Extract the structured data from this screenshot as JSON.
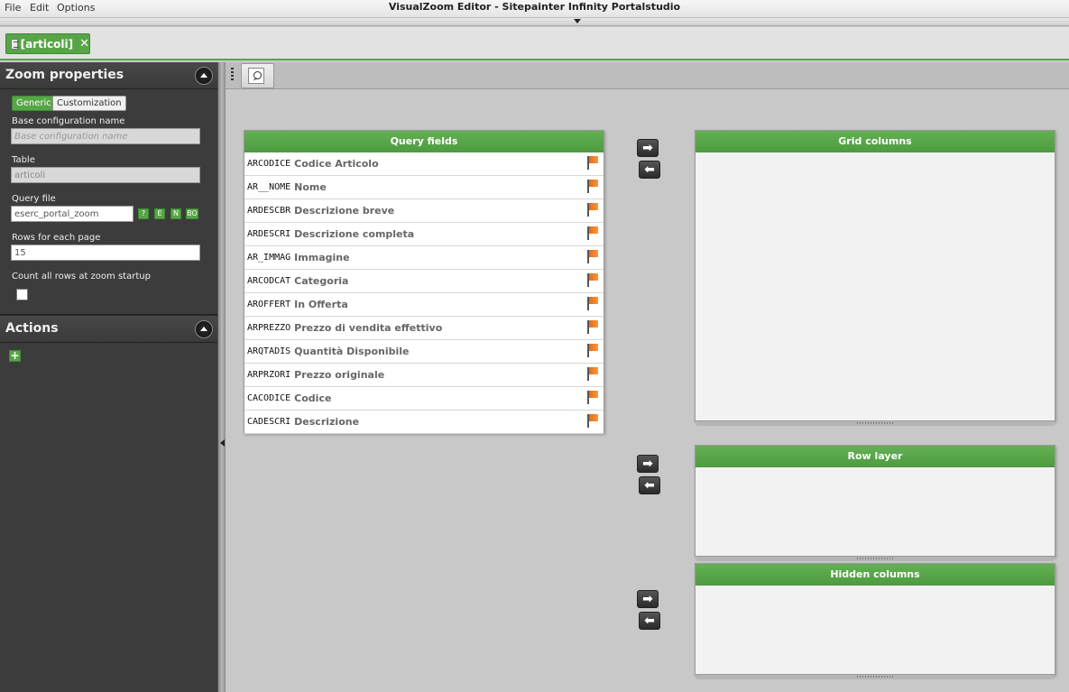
{
  "menu": {
    "file": "File",
    "edit": "Edit",
    "options": "Options"
  },
  "app_title": "VisualZoom Editor - Sitepainter Infinity Portalstudio",
  "doc_tab": {
    "label": "[articoli]",
    "close": "✕"
  },
  "zoom_properties": {
    "title": "Zoom properties",
    "tabs": [
      "Generic",
      "Customization"
    ],
    "base_config_label": "Base configuration name",
    "base_config_placeholder": "Base configuration name",
    "table_label": "Table",
    "table_value": "articoli",
    "query_file_label": "Query file",
    "query_file_value": "eserc_portal_zoom",
    "query_buttons": [
      "?",
      "E",
      "N",
      "BO"
    ],
    "rows_label": "Rows for each page",
    "rows_value": "15",
    "count_rows_label": "Count all rows at zoom startup",
    "count_rows_checked": false
  },
  "actions": {
    "title": "Actions",
    "add": "+"
  },
  "query_fields": {
    "title": "Query fields",
    "rows": [
      {
        "name": "ARCODICE",
        "desc": "Codice Articolo"
      },
      {
        "name": "AR__NOME",
        "desc": "Nome"
      },
      {
        "name": "ARDESCBR",
        "desc": "Descrizione breve"
      },
      {
        "name": "ARDESCRI",
        "desc": "Descrizione completa"
      },
      {
        "name": "AR_IMMAG",
        "desc": "Immagine"
      },
      {
        "name": "ARCODCAT",
        "desc": "Categoria"
      },
      {
        "name": "AROFFERT",
        "desc": "In Offerta"
      },
      {
        "name": "ARPREZZO",
        "desc": "Prezzo di vendita effettivo"
      },
      {
        "name": "ARQTADIS",
        "desc": "Quantità Disponibile"
      },
      {
        "name": "ARPRZORI",
        "desc": "Prezzo originale"
      },
      {
        "name": "CACODICE",
        "desc": "Codice"
      },
      {
        "name": "CADESCRI",
        "desc": "Descrizione"
      }
    ]
  },
  "grid_columns": {
    "title": "Grid columns"
  },
  "row_layer": {
    "title": "Row layer"
  },
  "hidden_columns": {
    "title": "Hidden columns"
  },
  "arrows": {
    "right": "➡",
    "left": "⬅"
  }
}
